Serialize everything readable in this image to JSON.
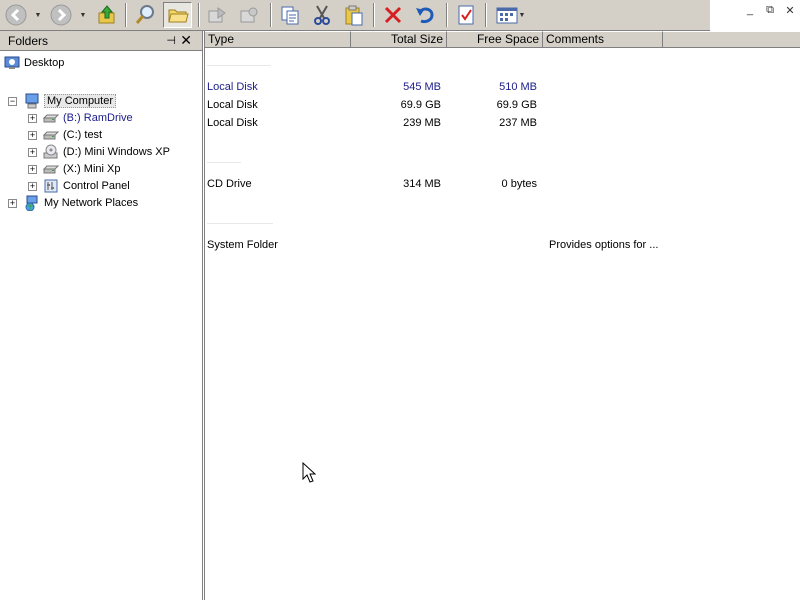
{
  "toolbar": {
    "buttons": [
      {
        "name": "back-button",
        "icon": "back-arrow-icon"
      },
      {
        "name": "forward-button",
        "icon": "forward-arrow-icon"
      },
      {
        "name": "up-button",
        "icon": "up-folder-icon"
      },
      {
        "name": "search-button",
        "icon": "search-icon"
      },
      {
        "name": "folders-button",
        "icon": "folder-icon"
      },
      {
        "name": "move-to-button",
        "icon": "move-to-icon"
      },
      {
        "name": "copy-to-button",
        "icon": "copy-to-icon"
      },
      {
        "name": "copy-button",
        "icon": "copy-icon"
      },
      {
        "name": "cut-button",
        "icon": "scissors-icon"
      },
      {
        "name": "paste-button",
        "icon": "paste-icon"
      },
      {
        "name": "delete-button",
        "icon": "delete-x-icon"
      },
      {
        "name": "undo-button",
        "icon": "undo-icon"
      },
      {
        "name": "properties-button",
        "icon": "properties-icon"
      },
      {
        "name": "views-button",
        "icon": "views-icon"
      }
    ]
  },
  "window_controls": {
    "minimize": "_",
    "restore": "⧉",
    "close": "✕"
  },
  "folders": {
    "title": "Folders",
    "pin": "⊣",
    "close": "✕",
    "items": [
      {
        "label": "Desktop",
        "icon": "desktop-icon"
      },
      {
        "label": "My Computer",
        "icon": "computer-icon",
        "expander": "−"
      },
      {
        "label": "(B:) RamDrive",
        "icon": "drive-icon",
        "expander": "+"
      },
      {
        "label": "(C:) test",
        "icon": "drive-icon",
        "expander": "+"
      },
      {
        "label": "(D:) Mini Windows XP",
        "icon": "cd-drive-icon",
        "expander": "+"
      },
      {
        "label": "(X:) Mini Xp",
        "icon": "drive-icon",
        "expander": "+"
      },
      {
        "label": "Control Panel",
        "icon": "control-panel-icon",
        "expander": "+"
      },
      {
        "label": "My Network Places",
        "icon": "network-icon",
        "expander": "+"
      }
    ]
  },
  "list": {
    "columns": {
      "type": "Type",
      "total_size": "Total Size",
      "free_space": "Free Space",
      "comments": "Comments"
    },
    "rows": [
      {
        "type": "Local Disk",
        "total": "545 MB",
        "free": "510 MB",
        "comments": ""
      },
      {
        "type": "Local Disk",
        "total": "69.9 GB",
        "free": "69.9 GB",
        "comments": ""
      },
      {
        "type": "Local Disk",
        "total": "239 MB",
        "free": "237 MB",
        "comments": ""
      },
      {
        "type": "CD Drive",
        "total": "314 MB",
        "free": "0 bytes",
        "comments": ""
      },
      {
        "type": "System Folder",
        "total": "",
        "free": "",
        "comments": "Provides options for ..."
      }
    ]
  },
  "colors": {
    "selected_text": "#1c1c8c",
    "chrome": "#d4d0c8",
    "delete_red": "#d42020",
    "undo_blue": "#1e5bb8"
  }
}
